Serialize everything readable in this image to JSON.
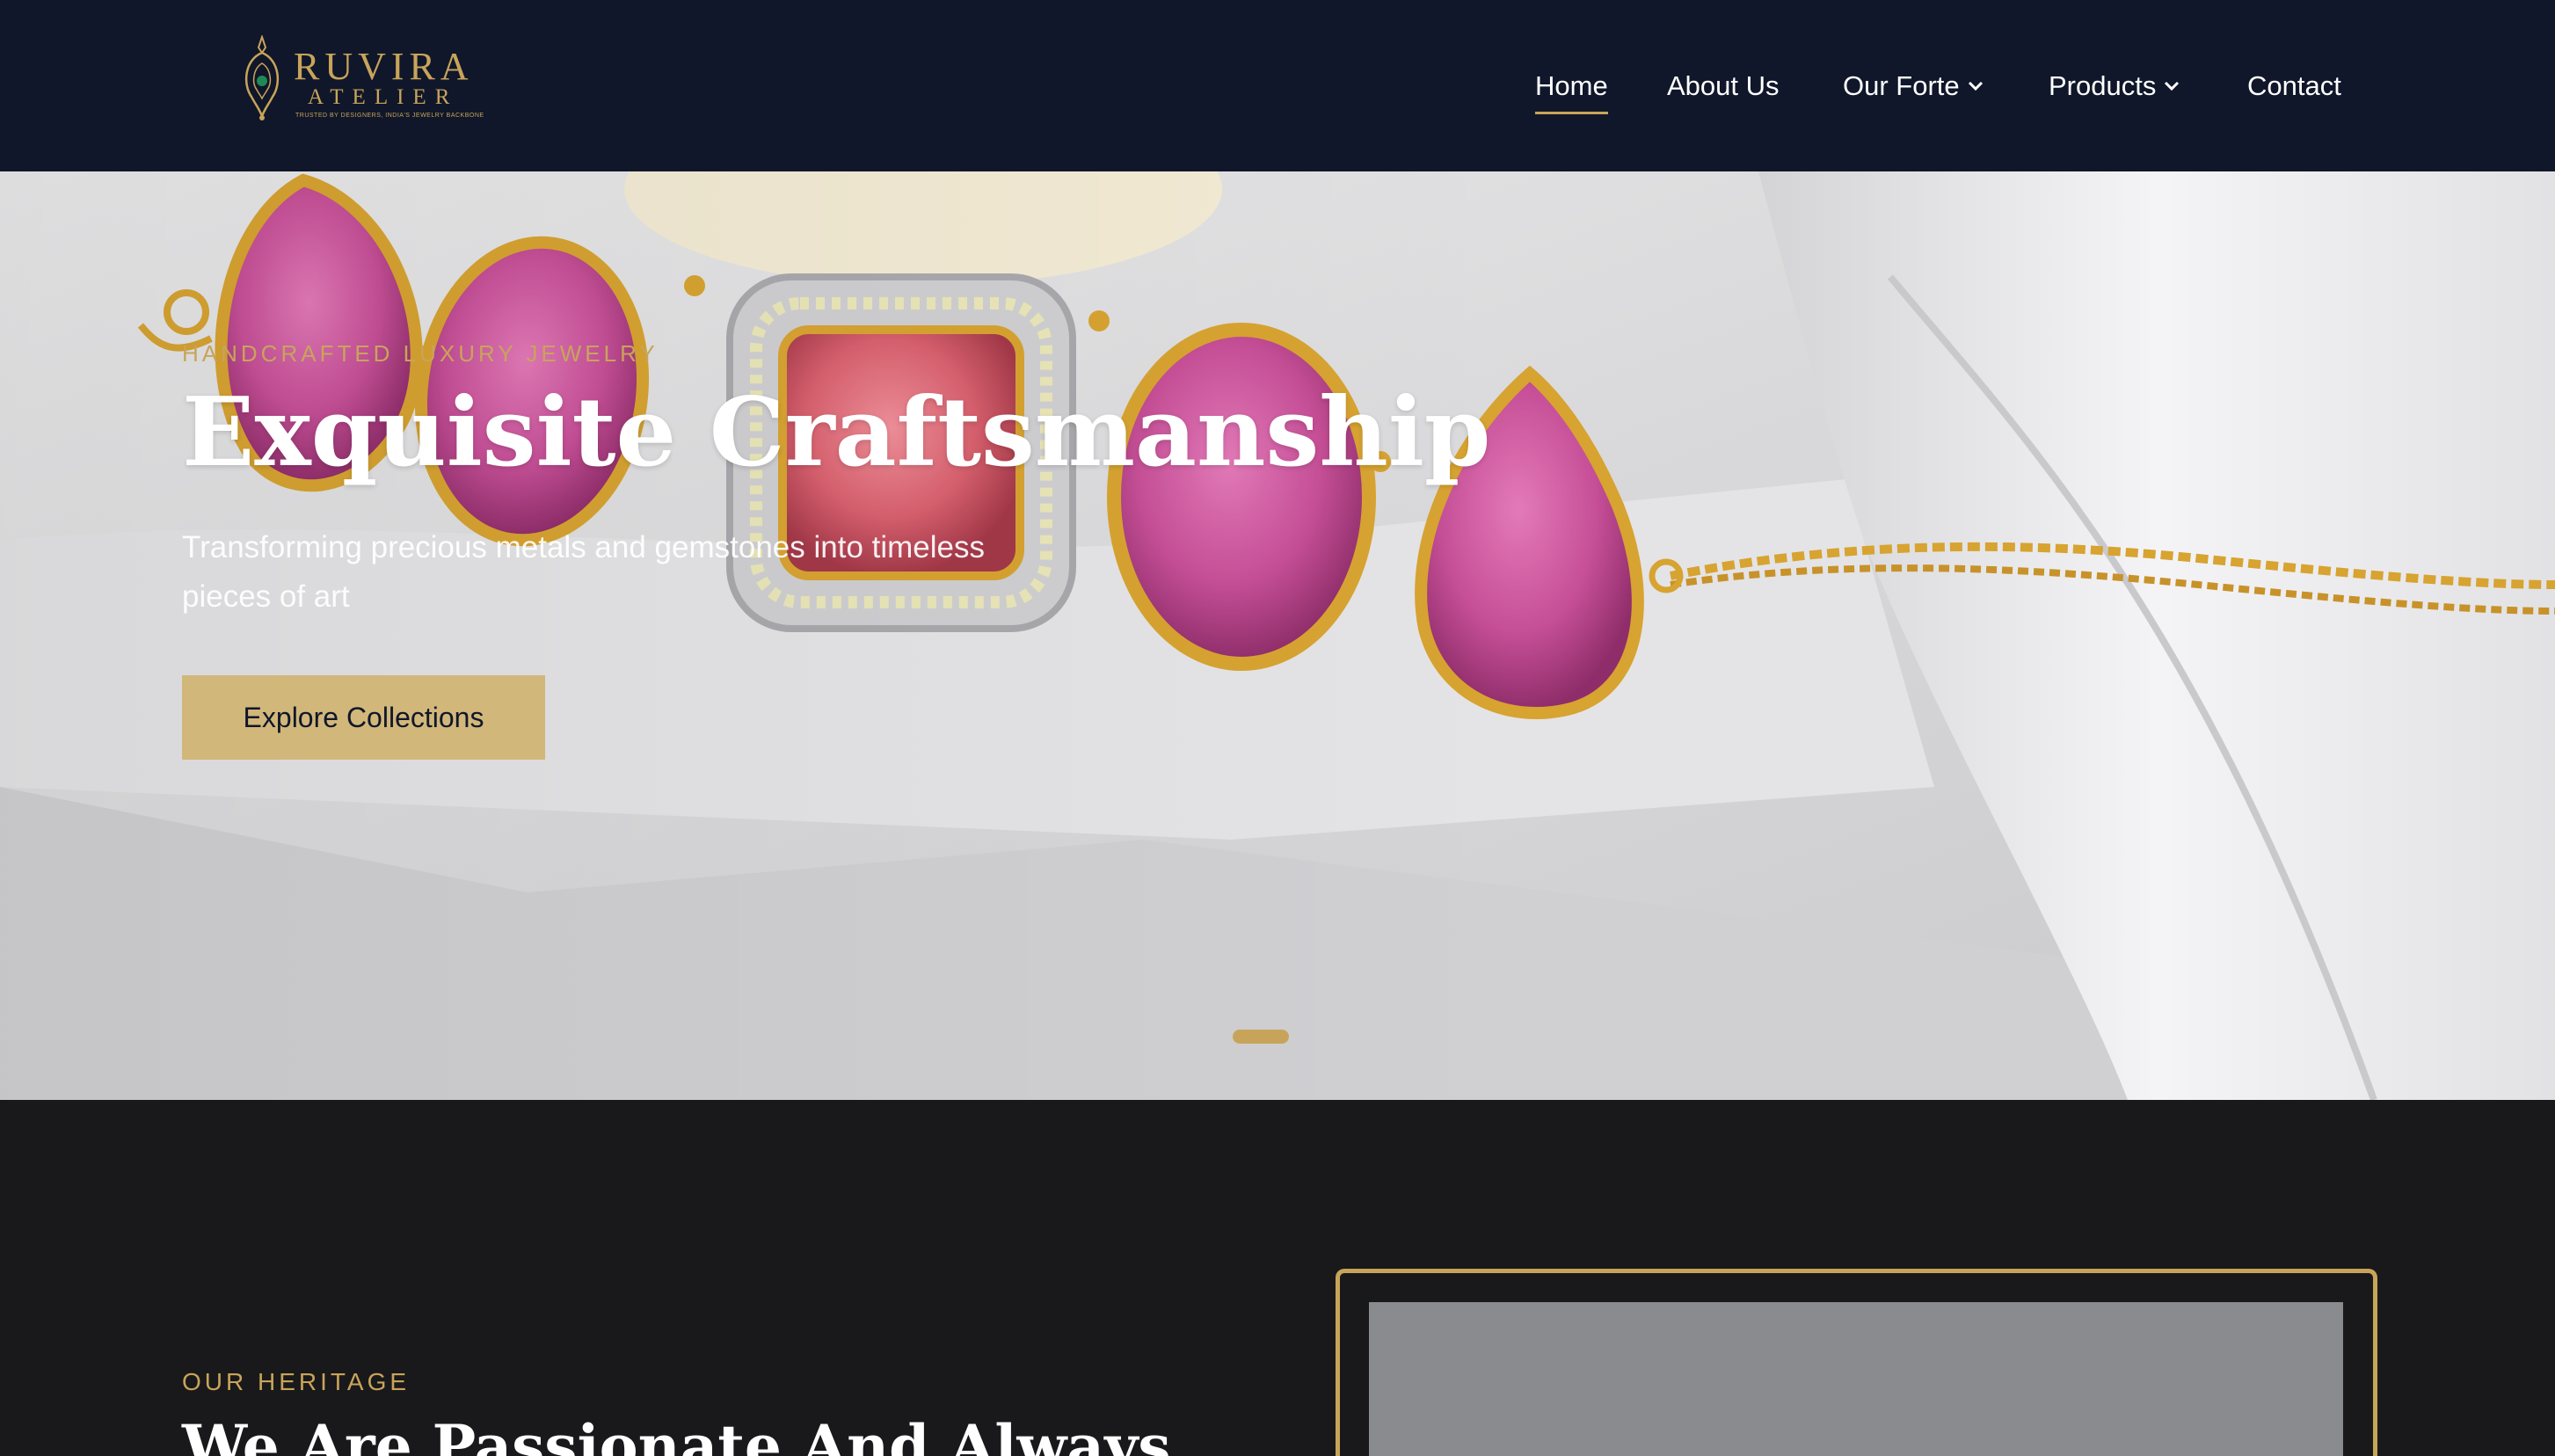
{
  "brand": {
    "name": "RUVIRA",
    "subtitle": "ATELIER",
    "tagline": "TRUSTED BY DESIGNERS, INDIA'S JEWELRY BACKBONE",
    "color": "#c8a45a"
  },
  "nav": {
    "items": [
      {
        "label": "Home",
        "active": true
      },
      {
        "label": "About Us"
      },
      {
        "label": "Our Forte",
        "dropdown": true
      },
      {
        "label": "Products",
        "dropdown": true
      },
      {
        "label": "Contact"
      }
    ]
  },
  "hero": {
    "eyebrow": "HANDCRAFTED LUXURY JEWELRY",
    "title": "Exquisite Craftsmanship",
    "subtitle": "Transforming precious metals and gemstones into timeless pieces of art",
    "cta_label": "Explore Collections",
    "active_slide": 1,
    "total_slides": 1
  },
  "heritage": {
    "eyebrow": "OUR HERITAGE",
    "title": "We Are Passionate And Always"
  },
  "colors": {
    "header_bg": "#10172a",
    "gold": "#c8a45a",
    "button_bg": "#d2b77a",
    "section_bg": "#19191b"
  }
}
